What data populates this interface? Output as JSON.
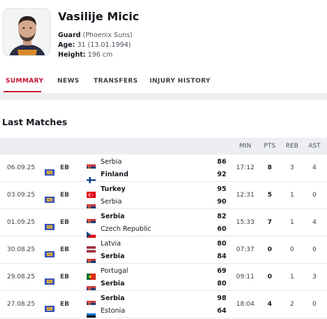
{
  "player": {
    "name": "Vasilije Micic",
    "position_label": "Guard",
    "position_team": "(Phoenix Suns)",
    "age_label": "Age:",
    "age_value": "31 (13.01.1994)",
    "height_label": "Height:",
    "height_value": "196 cm"
  },
  "tabs": [
    {
      "label": "SUMMARY",
      "active": true
    },
    {
      "label": "NEWS",
      "active": false
    },
    {
      "label": "TRANSFERS",
      "active": false
    },
    {
      "label": "INJURY HISTORY",
      "active": false
    }
  ],
  "section_title": "Last Matches",
  "columns": [
    "MIN",
    "PTS",
    "REB",
    "AST"
  ],
  "matches": [
    {
      "date": "06.09.25",
      "comp": "EB",
      "team1": {
        "name": "Serbia",
        "flag": "serbia-flag",
        "score": "86",
        "winner": false
      },
      "team2": {
        "name": "Finland",
        "flag": "finland-flag",
        "score": "92",
        "winner": true
      },
      "min": "17:12",
      "pts": "8",
      "reb": "3",
      "ast": "4"
    },
    {
      "date": "03.09.25",
      "comp": "EB",
      "team1": {
        "name": "Turkey",
        "flag": "turkey-flag",
        "score": "95",
        "winner": true
      },
      "team2": {
        "name": "Serbia",
        "flag": "serbia-flag",
        "score": "90",
        "winner": false
      },
      "min": "12:31",
      "pts": "5",
      "reb": "1",
      "ast": "0"
    },
    {
      "date": "01.09.25",
      "comp": "EB",
      "team1": {
        "name": "Serbia",
        "flag": "serbia-flag",
        "score": "82",
        "winner": true
      },
      "team2": {
        "name": "Czech Republic",
        "flag": "czech-flag",
        "score": "60",
        "winner": false
      },
      "min": "15:33",
      "pts": "7",
      "reb": "1",
      "ast": "4"
    },
    {
      "date": "30.08.25",
      "comp": "EB",
      "team1": {
        "name": "Latvia",
        "flag": "latvia-flag",
        "score": "80",
        "winner": false
      },
      "team2": {
        "name": "Serbia",
        "flag": "serbia-flag",
        "score": "84",
        "winner": true
      },
      "min": "07:37",
      "pts": "0",
      "reb": "0",
      "ast": "0"
    },
    {
      "date": "29.08.25",
      "comp": "EB",
      "team1": {
        "name": "Portugal",
        "flag": "portugal-flag",
        "score": "69",
        "winner": false
      },
      "team2": {
        "name": "Serbia",
        "flag": "serbia-flag",
        "score": "80",
        "winner": true
      },
      "min": "09:11",
      "pts": "0",
      "reb": "1",
      "ast": "3"
    },
    {
      "date": "27.08.25",
      "comp": "EB",
      "team1": {
        "name": "Serbia",
        "flag": "serbia-flag",
        "score": "98",
        "winner": true
      },
      "team2": {
        "name": "Estonia",
        "flag": "estonia-flag",
        "score": "64",
        "winner": false
      },
      "min": "18:04",
      "pts": "4",
      "reb": "2",
      "ast": "0"
    }
  ],
  "colors": {
    "accent": "#c8102e",
    "header_bg": "#eceef1"
  }
}
